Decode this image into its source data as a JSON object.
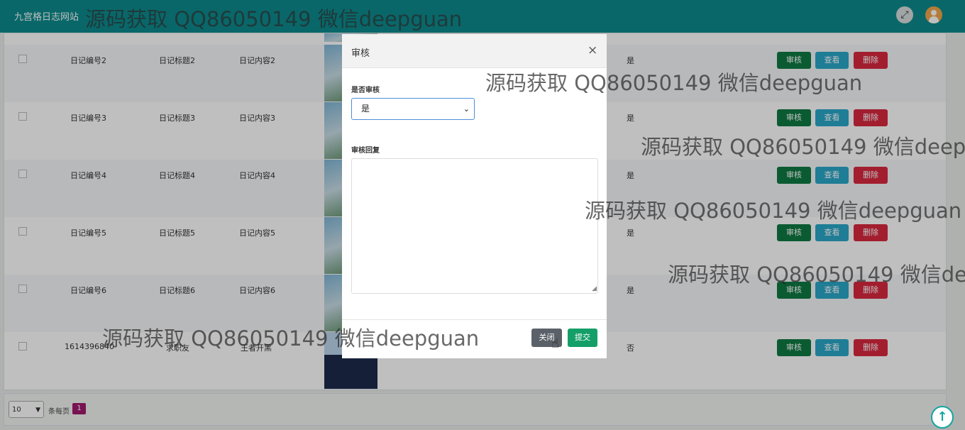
{
  "header": {
    "brand": "九宫格日志网站",
    "fullscreen_icon": "expand-arrows-icon",
    "avatar_icon": "user-avatar-icon"
  },
  "table": {
    "rows": [
      {
        "num": "日记编号2",
        "title": "日记标题2",
        "content": "日记内容2",
        "audited": "是",
        "audit_btn": "审核",
        "view_btn": "查看",
        "delete_btn": "删除"
      },
      {
        "num": "日记编号3",
        "title": "日记标题3",
        "content": "日记内容3",
        "audited": "是",
        "audit_btn": "审核",
        "view_btn": "查看",
        "delete_btn": "删除"
      },
      {
        "num": "日记编号4",
        "title": "日记标题4",
        "content": "日记内容4",
        "audited": "是",
        "audit_btn": "审核",
        "view_btn": "查看",
        "delete_btn": "删除"
      },
      {
        "num": "日记编号5",
        "title": "日记标题5",
        "content": "日记内容5",
        "audited": "是",
        "audit_btn": "审核",
        "view_btn": "查看",
        "delete_btn": "删除"
      },
      {
        "num": "日记编号6",
        "title": "日记标题6",
        "content": "日记内容6",
        "audited": "是",
        "audit_btn": "审核",
        "view_btn": "查看",
        "delete_btn": "删除"
      },
      {
        "num": "1614396840",
        "title": "求职友",
        "content": "王者开黑",
        "audited": "否",
        "audit_btn": "审核",
        "view_btn": "查看",
        "delete_btn": "删除"
      }
    ]
  },
  "pager": {
    "page_size": "10",
    "per_page_label": "条每页",
    "current_page": "1"
  },
  "modal": {
    "title": "审核",
    "close_symbol": "×",
    "audit_label": "是否审核",
    "audit_value": "是",
    "reply_label": "审核回复",
    "reply_value": "",
    "close_button": "关闭",
    "submit_button": "提交"
  },
  "watermark": {
    "text": "源码获取 QQ86050149 微信deepguan"
  },
  "colors": {
    "header": "#0d8a8c",
    "audit_btn": "#0f7a43",
    "view_btn": "#2aa7c9",
    "delete_btn": "#d8293f",
    "submit": "#149f69",
    "page_active": "#a01a6e"
  }
}
